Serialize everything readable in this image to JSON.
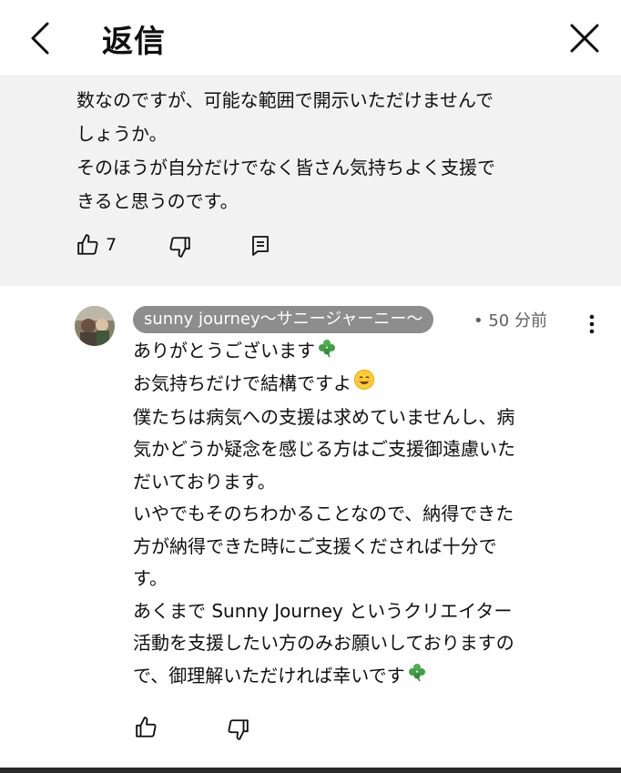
{
  "header": {
    "title": "返信",
    "back_icon": "chevron-left-icon",
    "close_icon": "close-icon"
  },
  "parent_comment": {
    "lines": [
      "数なのですが、可能な範囲で開示いただけませんで",
      "しょうか。",
      "そのほうが自分だけでなく皆さん気持ちよく支援で",
      "きると思うのです。"
    ],
    "like_count": "7"
  },
  "reply": {
    "author": "sunny journey～サニージャーニー～",
    "separator": "•",
    "time": "50 分前",
    "lines": [
      "ありがとうございます",
      "お気持ちだけで結構ですよ",
      "僕たちは病気への支援は求めていませんし、病",
      "気かどうか疑念を感じる方はご支援御遠慮いた",
      "だいております。",
      "いやでもそのちわかることなので、納得できた",
      "方が納得できた時にご支援くだされば十分で",
      "す。",
      "あくまで Sunny Journey というクリエイター",
      "活動を支援したい方のみお願いしておりますの",
      "で、御理解いただければ幸いです"
    ],
    "emojis": [
      "clover-emoji",
      "smile-emoji",
      "clover-emoji"
    ]
  },
  "colors": {
    "parent_bg": "#f2f2f2",
    "chip_bg": "#8d8d8d",
    "text": "#0f0f0f",
    "meta": "#606060"
  }
}
